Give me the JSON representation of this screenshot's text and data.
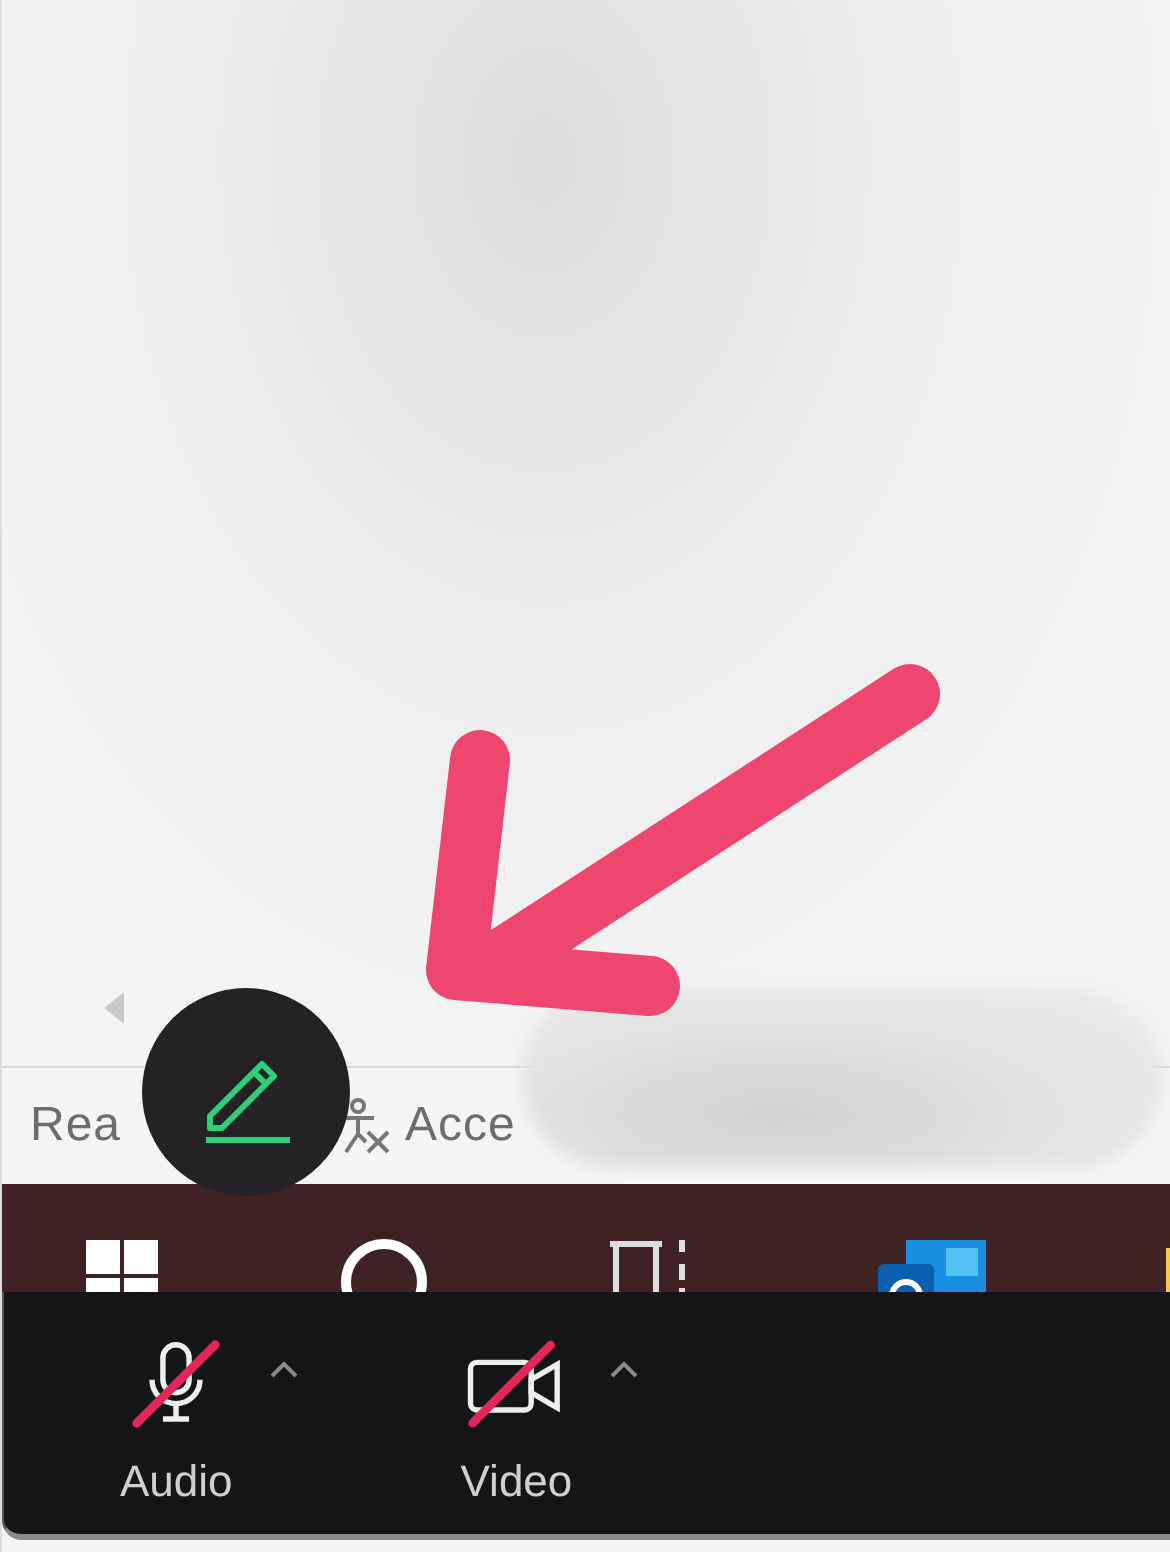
{
  "status_bar": {
    "items": [
      {
        "kind": "text",
        "label": "Rea"
      },
      {
        "kind": "accessibility",
        "label": "Acce"
      }
    ]
  },
  "meeting_toolbar": {
    "buttons": [
      {
        "kind": "audio",
        "label": "Audio",
        "muted": true
      },
      {
        "kind": "video",
        "label": "Video",
        "muted": true
      }
    ]
  }
}
